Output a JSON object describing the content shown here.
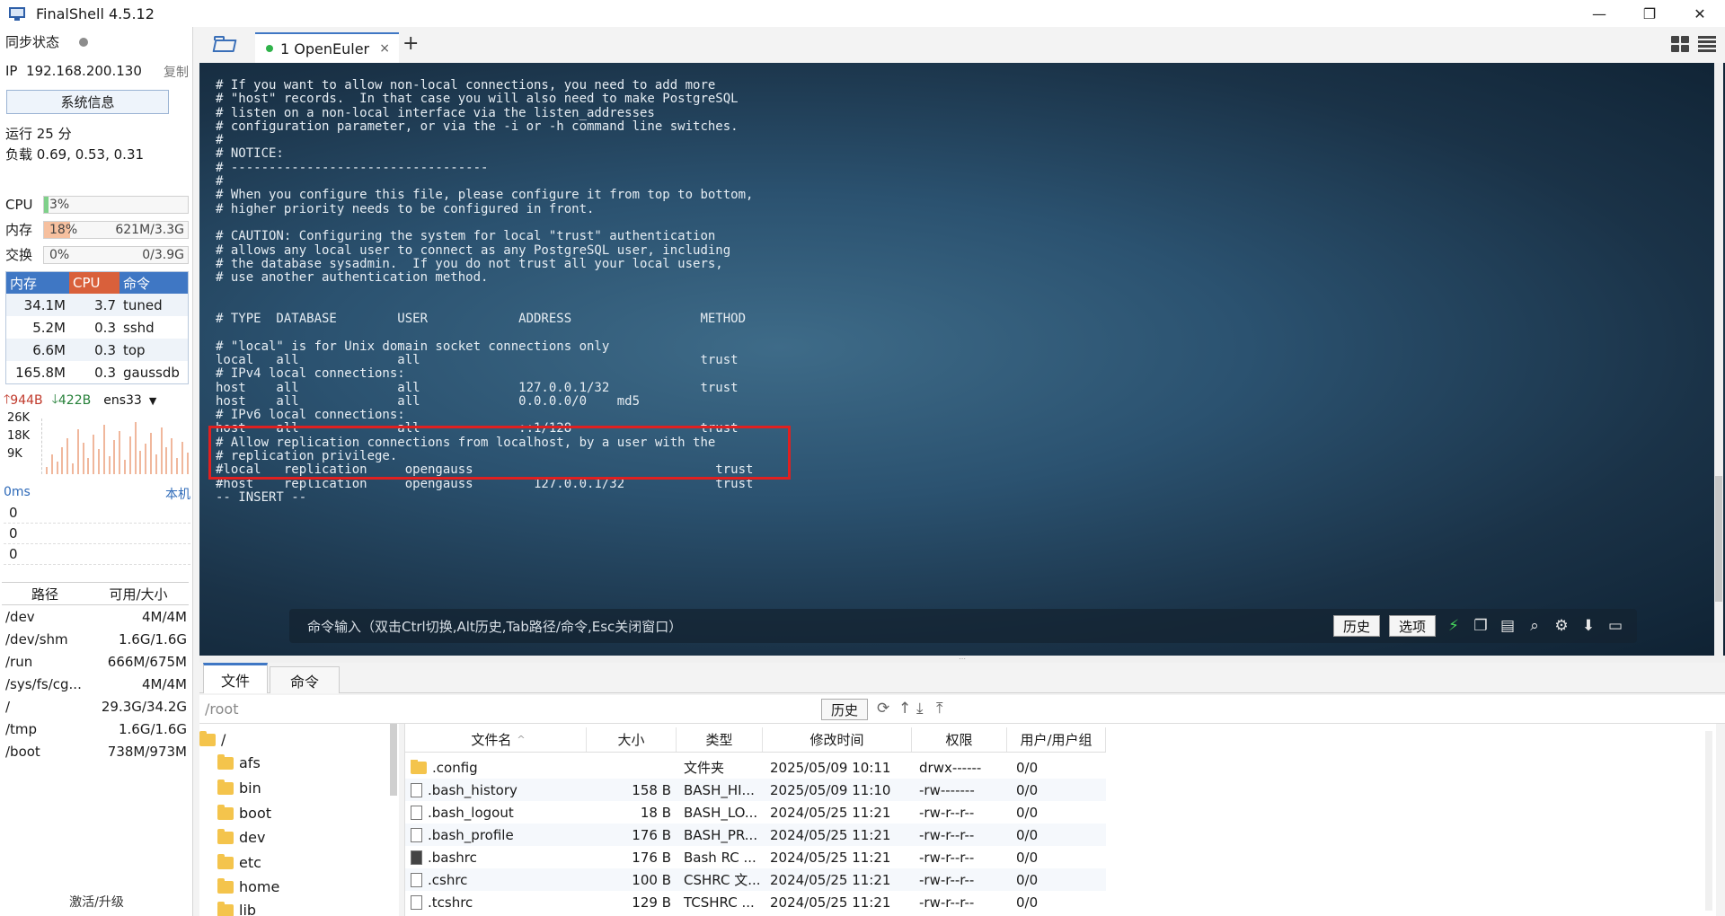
{
  "window": {
    "title": "FinalShell 4.5.12",
    "minimize": "—",
    "restore": "❐",
    "close": "✕"
  },
  "sidebar": {
    "sync_label": "同步状态",
    "ip_label": "IP",
    "ip_value": "192.168.200.130",
    "copy_label": "复制",
    "sysinfo_button": "系统信息",
    "uptime": "运行 25 分",
    "load": "负载 0.69, 0.53, 0.31",
    "meters": {
      "cpu": {
        "label": "CPU",
        "percent_text": "3%",
        "amount": "",
        "fill": 0.03
      },
      "mem": {
        "label": "内存",
        "percent_text": "18%",
        "amount": "621M/3.3G",
        "fill": 0.18
      },
      "swap": {
        "label": "交换",
        "percent_text": "0%",
        "amount": "0/3.9G",
        "fill": 0.0
      }
    },
    "process_headers": [
      "内存",
      "CPU",
      "命令"
    ],
    "processes": [
      {
        "mem": "34.1M",
        "cpu": "3.7",
        "cmd": "tuned"
      },
      {
        "mem": "5.2M",
        "cpu": "0.3",
        "cmd": "sshd"
      },
      {
        "mem": "6.6M",
        "cpu": "0.3",
        "cmd": "top"
      },
      {
        "mem": "165.8M",
        "cpu": "0.3",
        "cmd": "gaussdb"
      }
    ],
    "net": {
      "up": "944B",
      "down": "422B",
      "interface": "ens33",
      "y_labels": [
        "26K",
        "18K",
        "9K"
      ]
    },
    "ping": {
      "latency": "0ms",
      "target": "本机",
      "values": [
        "0",
        "0",
        "0"
      ]
    },
    "disk_headers": [
      "路径",
      "可用/大小"
    ],
    "disks": [
      {
        "path": "/dev",
        "size": "4M/4M"
      },
      {
        "path": "/dev/shm",
        "size": "1.6G/1.6G"
      },
      {
        "path": "/run",
        "size": "666M/675M"
      },
      {
        "path": "/sys/fs/cg...",
        "size": "4M/4M"
      },
      {
        "path": "/",
        "size": "29.3G/34.2G"
      },
      {
        "path": "/tmp",
        "size": "1.6G/1.6G"
      },
      {
        "path": "/boot",
        "size": "738M/973M"
      }
    ],
    "activate": "激活/升级"
  },
  "tabs": {
    "session": "1 OpenEuler",
    "close": "×",
    "add": "+"
  },
  "terminal": {
    "lines": [
      "# If you want to allow non-local connections, you need to add more",
      "# \"host\" records.  In that case you will also need to make PostgreSQL",
      "# listen on a non-local interface via the listen_addresses",
      "# configuration parameter, or via the -i or -h command line switches.",
      "#",
      "# NOTICE:",
      "# ----------------------------------",
      "#",
      "# When you configure this file, please configure it from top to bottom,",
      "# higher priority needs to be configured in front.",
      "",
      "# CAUTION: Configuring the system for local \"trust\" authentication",
      "# allows any local user to connect as any PostgreSQL user, including",
      "# the database sysadmin.  If you do not trust all your local users,",
      "# use another authentication method.",
      "",
      "",
      "# TYPE  DATABASE        USER            ADDRESS                 METHOD",
      "",
      "# \"local\" is for Unix domain socket connections only",
      "local   all             all                                     trust",
      "# IPv4 local connections:",
      "host    all             all             127.0.0.1/32            trust",
      "host    all             all             0.0.0.0/0    md5",
      "# IPv6 local connections:",
      "host    all             all             ::1/128                 trust",
      "# Allow replication connections from localhost, by a user with the",
      "# replication privilege.",
      "#local   replication     opengauss                                trust",
      "#host    replication     opengauss        127.0.0.1/32            trust",
      "-- INSERT --"
    ],
    "cmd_hint": "命令输入（双击Ctrl切换,Alt历史,Tab路径/命令,Esc关闭窗口）",
    "history_btn": "历史",
    "options_btn": "选项"
  },
  "filepanel": {
    "tab_files": "文件",
    "tab_commands": "命令",
    "path": "/root",
    "history_btn": "历史",
    "tree": [
      "/",
      "afs",
      "bin",
      "boot",
      "dev",
      "etc",
      "home",
      "lib"
    ],
    "headers": [
      "文件名",
      "大小",
      "类型",
      "修改时间",
      "权限",
      "用户/用户组"
    ],
    "files": [
      {
        "name": ".config",
        "size": "",
        "type": "文件夹",
        "time": "2025/05/09 10:11",
        "perm": "drwx------",
        "owner": "0/0",
        "kind": "folder"
      },
      {
        "name": ".bash_history",
        "size": "158 B",
        "type": "BASH_HI...",
        "time": "2025/05/09 11:10",
        "perm": "-rw-------",
        "owner": "0/0",
        "kind": "file"
      },
      {
        "name": ".bash_logout",
        "size": "18 B",
        "type": "BASH_LO...",
        "time": "2024/05/25 11:21",
        "perm": "-rw-r--r--",
        "owner": "0/0",
        "kind": "file"
      },
      {
        "name": ".bash_profile",
        "size": "176 B",
        "type": "BASH_PR...",
        "time": "2024/05/25 11:21",
        "perm": "-rw-r--r--",
        "owner": "0/0",
        "kind": "file"
      },
      {
        "name": ".bashrc",
        "size": "176 B",
        "type": "Bash RC ...",
        "time": "2024/05/25 11:21",
        "perm": "-rw-r--r--",
        "owner": "0/0",
        "kind": "dark"
      },
      {
        "name": ".cshrc",
        "size": "100 B",
        "type": "CSHRC 文...",
        "time": "2024/05/25 11:21",
        "perm": "-rw-r--r--",
        "owner": "0/0",
        "kind": "file"
      },
      {
        "name": ".tcshrc",
        "size": "129 B",
        "type": "TCSHRC ...",
        "time": "2024/05/25 11:21",
        "perm": "-rw-r--r--",
        "owner": "0/0",
        "kind": "file"
      }
    ]
  }
}
